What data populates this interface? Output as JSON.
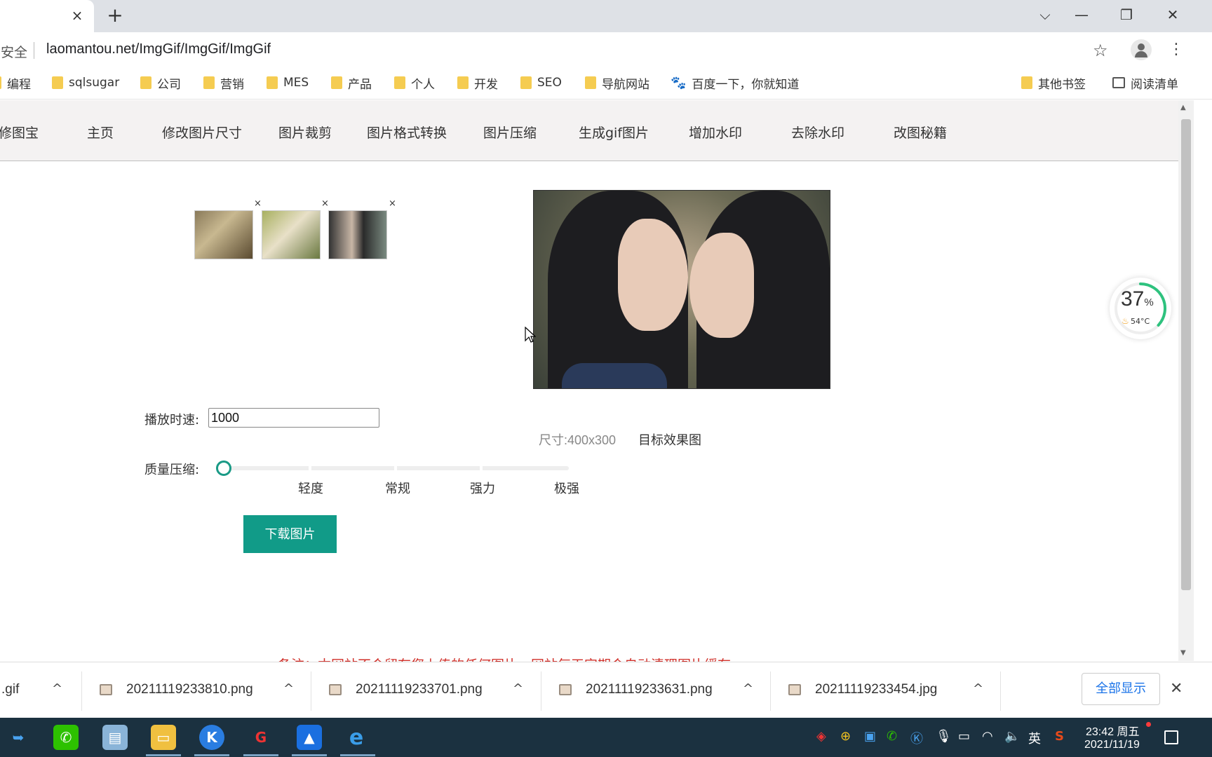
{
  "browser": {
    "tab_close": "×",
    "new_tab": "+",
    "window_controls": {
      "tabsearch": "⌵",
      "minimize": "—",
      "restore": "❐",
      "close": "✕"
    },
    "security_label": "不安全",
    "url": "laomantou.net/ImgGif/ImgGif/ImgGif",
    "bookmarks": [
      "编程",
      "sqlsugar",
      "公司",
      "营销",
      "MES",
      "产品",
      "个人",
      "开发",
      "SEO",
      "导航网站",
      "百度一下，你就知道"
    ],
    "other_bookmarks": "其他书签",
    "reading_list": "阅读清单"
  },
  "site": {
    "brand": "修图宝",
    "nav": [
      "主页",
      "修改图片尺寸",
      "图片裁剪",
      "图片格式转换",
      "图片压缩",
      "生成gif图片",
      "增加水印",
      "去除水印",
      "改图秘籍"
    ],
    "thumb_remove": "×",
    "preview_size": "尺寸:400x300",
    "preview_caption": "目标效果图",
    "speed_label": "播放时速:",
    "speed_value": "1000",
    "quality_label": "质量压缩:",
    "quality_ticks": [
      "轻度",
      "常规",
      "强力",
      "极强"
    ],
    "quality_level": 0,
    "download_button": "下载图片",
    "note": "备注：本网站不会留存您上传的任何图片，网站每天定期会自动清理图片缓存"
  },
  "monitor": {
    "percent": "37",
    "unit": "%",
    "temp": "54°C"
  },
  "downloads": {
    "items": [
      ".gif",
      "20211119233810.png",
      "20211119233701.png",
      "20211119233631.png",
      "20211119233454.jpg"
    ],
    "chevron": "^",
    "show_all": "全部显示",
    "close": "✕"
  },
  "taskbar": {
    "ime": "英",
    "time": "23:42 周五",
    "date": "2021/11/19"
  },
  "colors": {
    "accent": "#119b88",
    "note_red": "#d0302a",
    "taskbar": "#1b3140"
  }
}
